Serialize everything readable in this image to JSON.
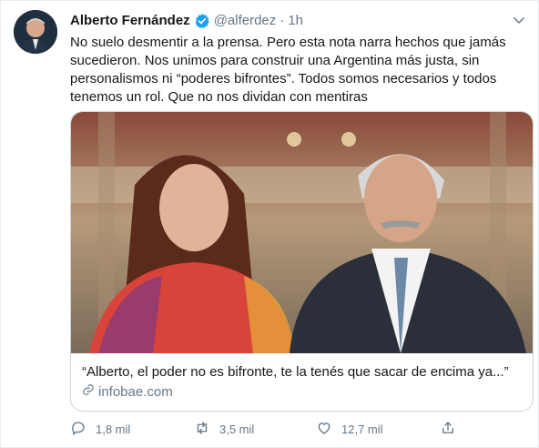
{
  "tweet": {
    "author_name": "Alberto Fernández",
    "handle": "@alferdez",
    "separator": "·",
    "time": "1h",
    "text": "No suelo desmentir a la prensa. Pero esta nota narra hechos que jamás sucedieron. Nos unimos para construir una Argentina más justa, sin personalismos ni “poderes bifrontes”. Todos somos necesarios y todos tenemos un rol. Que no nos dividan con mentiras",
    "card": {
      "title": "“Alberto, el poder no es bifronte, te la tenés que sacar de encima ya...”",
      "domain": "infobae.com"
    },
    "actions": {
      "replies": "1,8 mil",
      "retweets": "3,5 mil",
      "likes": "12,7 mil"
    }
  },
  "icons": {
    "verified": "verified-badge-icon",
    "caret": "chevron-down-icon",
    "link": "link-icon",
    "reply": "reply-icon",
    "retweet": "retweet-icon",
    "like": "heart-icon",
    "share": "share-icon"
  },
  "colors": {
    "verified_blue": "#1da1f2",
    "secondary_text": "#657786",
    "border": "#ccd6dd"
  }
}
